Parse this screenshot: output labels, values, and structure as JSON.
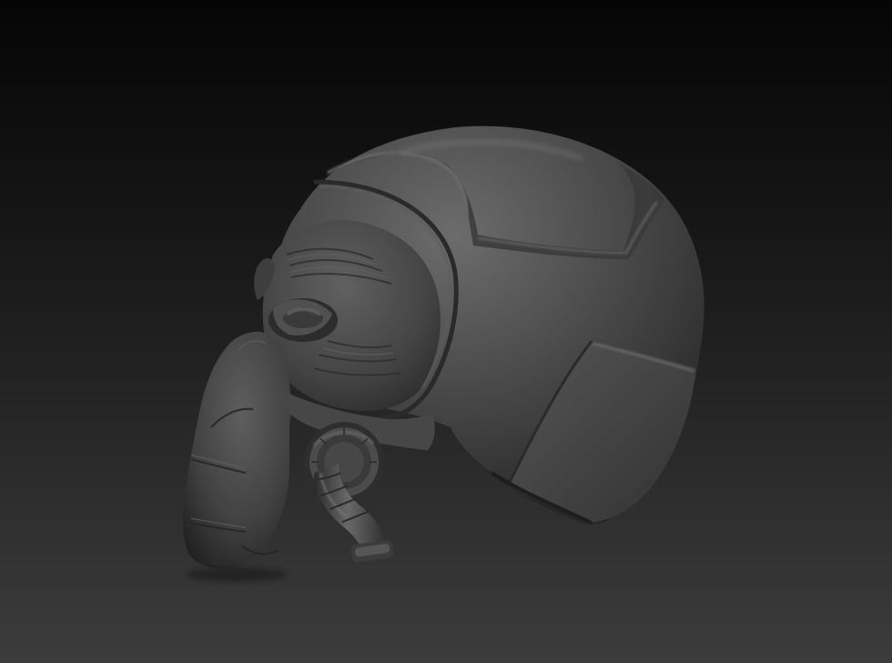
{
  "scene": {
    "subject": "sculpted-helmet-mask",
    "background_top": "#050505",
    "background_bottom": "#3c3c3c",
    "material_highlight": "#6c6c6c",
    "material_mid": "#4a4a4a",
    "material_shadow": "#1e1e1e"
  }
}
